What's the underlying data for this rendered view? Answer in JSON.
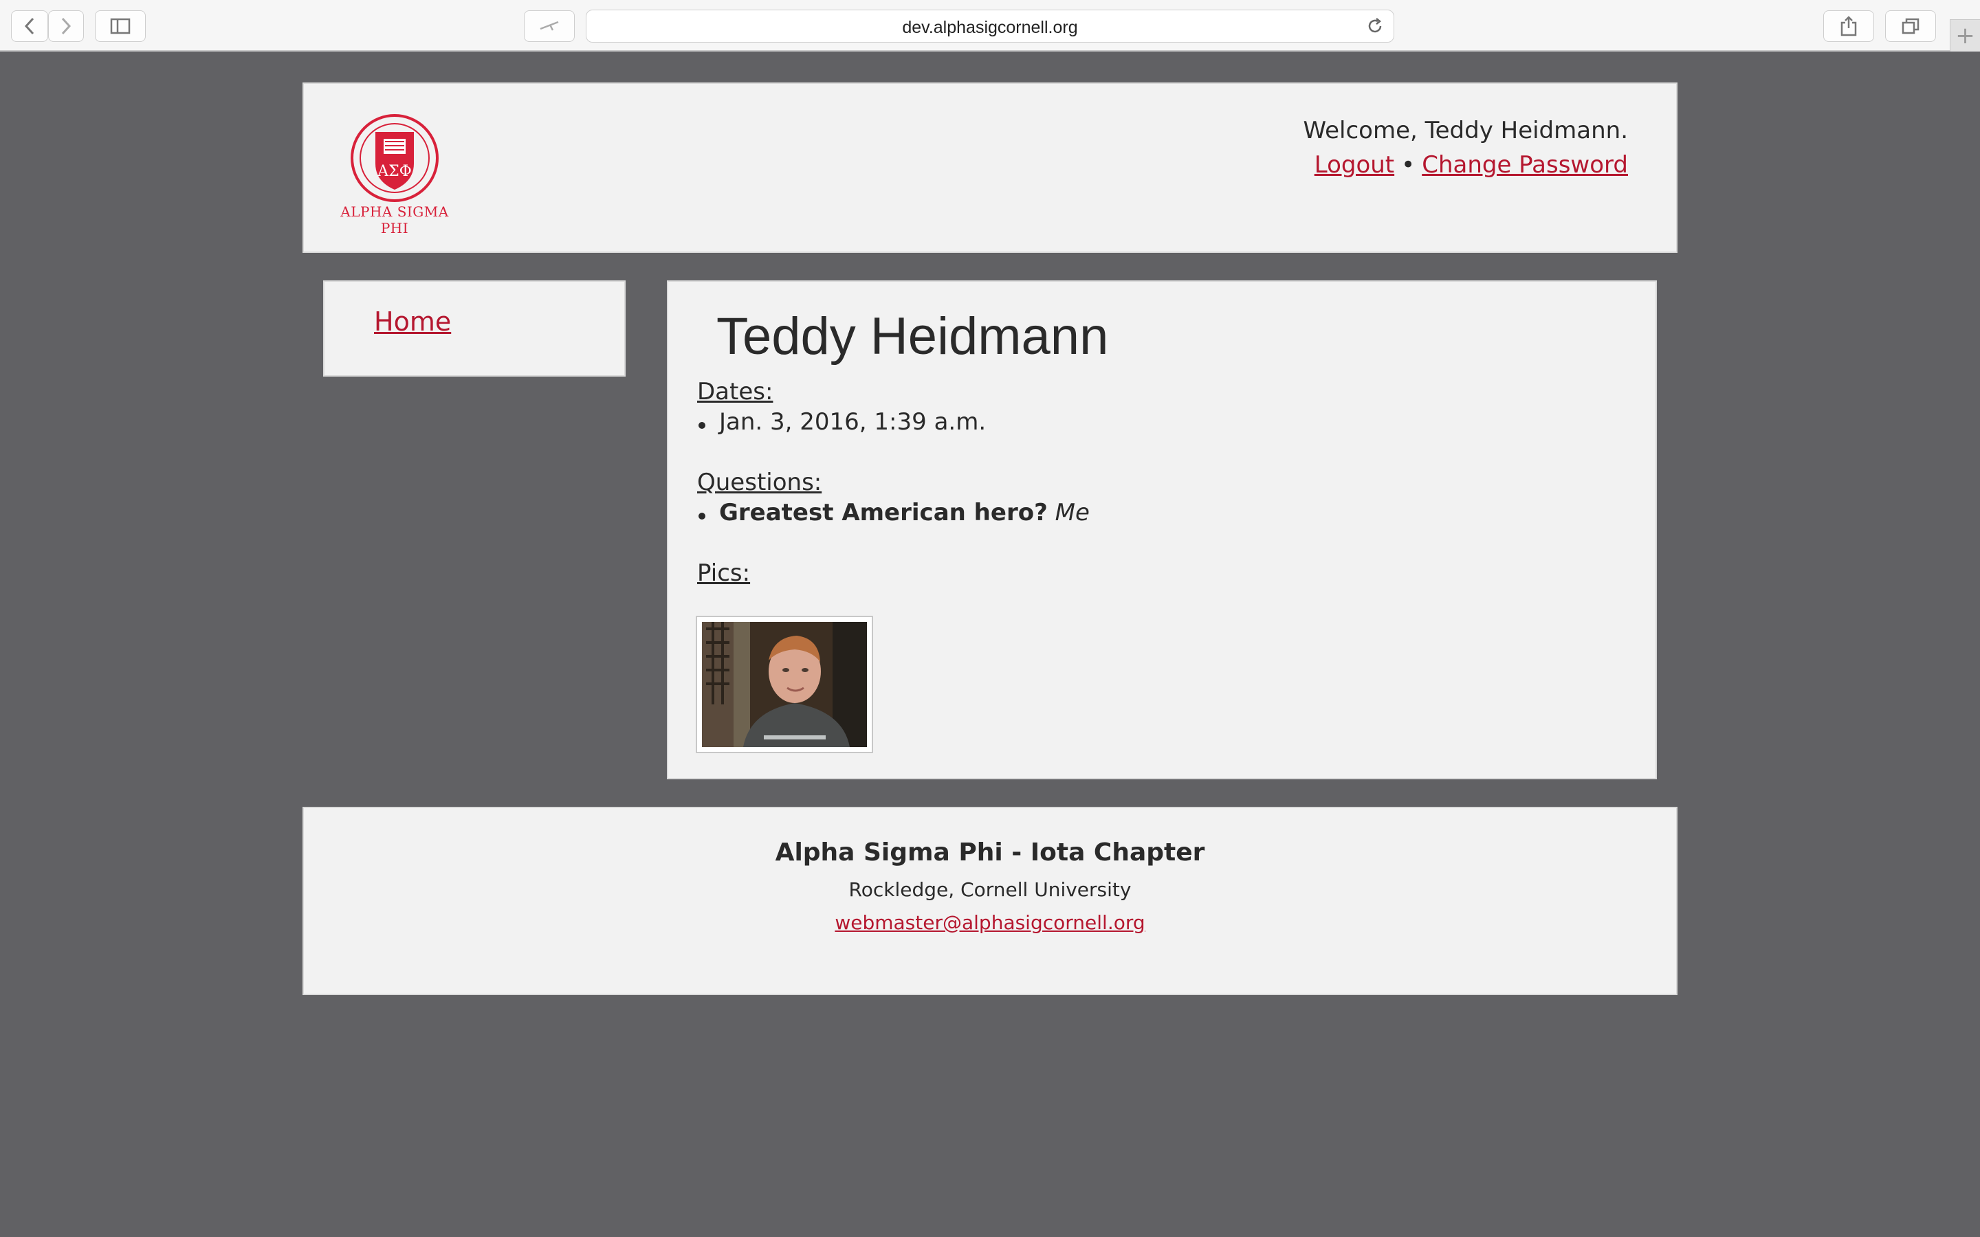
{
  "browser": {
    "url": "dev.alphasigcornell.org",
    "new_tab_symbol": "+"
  },
  "header": {
    "logo_text": "ALPHA SIGMA PHI",
    "welcome": "Welcome, Teddy Heidmann.",
    "logout_label": "Logout",
    "separator": "•",
    "change_password_label": "Change Password"
  },
  "sidebar": {
    "items": [
      {
        "label": "Home"
      }
    ]
  },
  "main": {
    "title": "Teddy Heidmann",
    "dates_label": "Dates:",
    "dates": [
      "Jan. 3, 2016, 1:39 a.m."
    ],
    "questions_label": "Questions:",
    "questions": [
      {
        "question": "Greatest American hero?",
        "answer": "Me"
      }
    ],
    "pics_label": "Pics:"
  },
  "footer": {
    "title": "Alpha Sigma Phi - Iota Chapter",
    "subtitle": "Rockledge, Cornell University",
    "email": "webmaster@alphasigcornell.org"
  },
  "colors": {
    "page_background": "#616164",
    "panel_background": "#f2f2f2",
    "link": "#b5172f",
    "logo_red": "#d8213a"
  }
}
